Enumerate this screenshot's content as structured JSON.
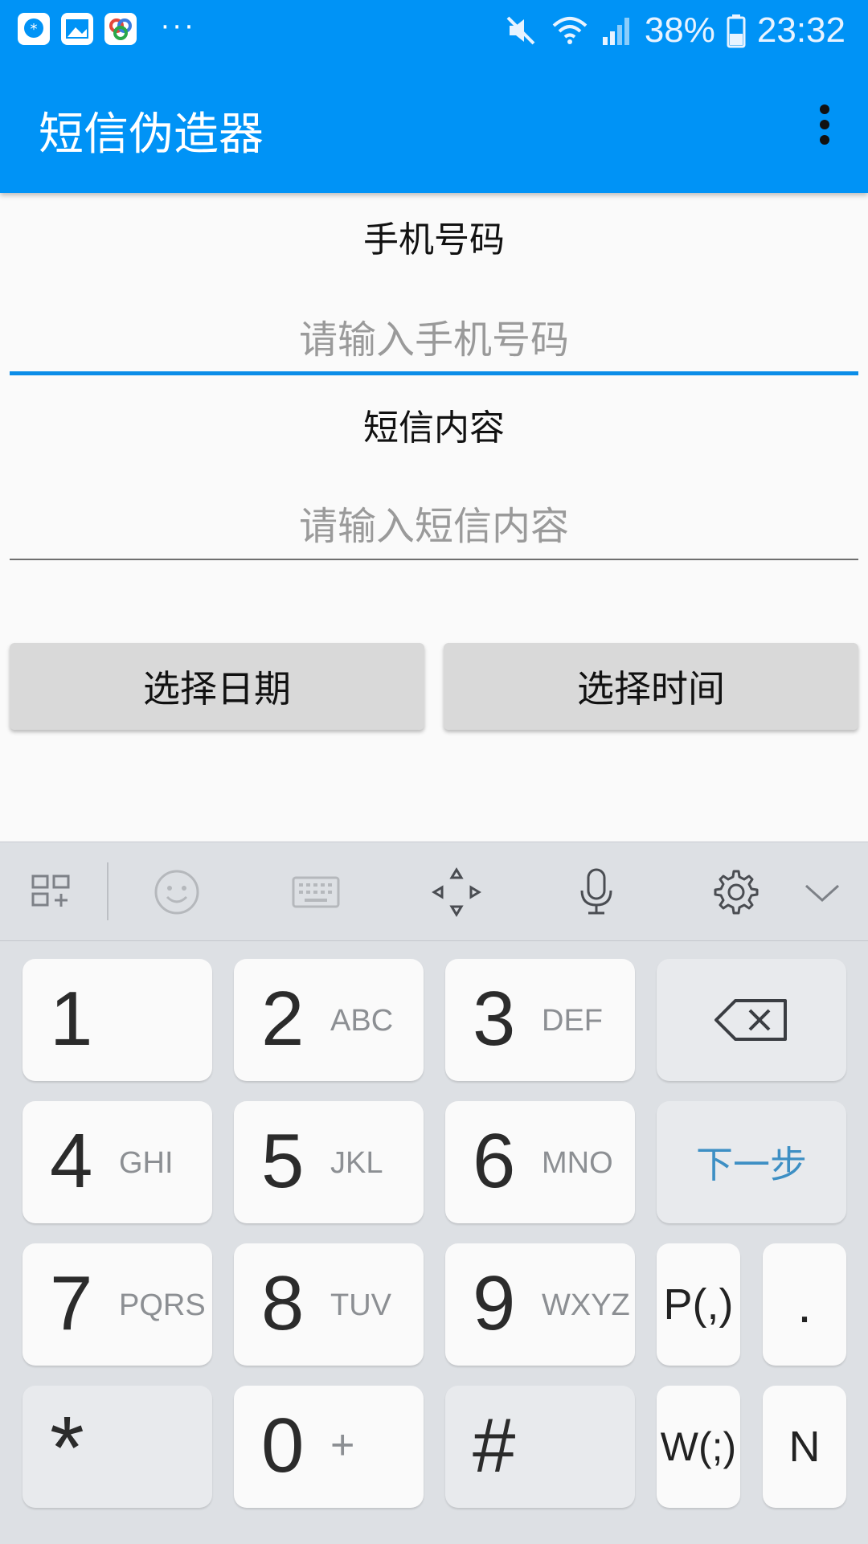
{
  "status_bar": {
    "battery": "38%",
    "time": "23:32",
    "notification_more": "···"
  },
  "app_bar": {
    "title": "短信伪造器"
  },
  "form": {
    "phone_label": "手机号码",
    "phone_placeholder": "请输入手机号码",
    "sms_label": "短信内容",
    "sms_placeholder": "请输入短信内容",
    "pick_date_label": "选择日期",
    "pick_time_label": "选择时间"
  },
  "colors": {
    "primary": "#0093f6",
    "focus_line": "#0b8de8",
    "next_text": "#3d8fc4"
  },
  "keyboard": {
    "toolbar_icons": [
      "grid-plus-icon",
      "emoji-icon",
      "keyboard-icon",
      "move-arrows-icon",
      "microphone-icon",
      "settings-icon",
      "collapse-chevron-icon"
    ],
    "keys": {
      "k1": {
        "num": "1",
        "sub": ""
      },
      "k2": {
        "num": "2",
        "sub": "ABC"
      },
      "k3": {
        "num": "3",
        "sub": "DEF"
      },
      "k4": {
        "num": "4",
        "sub": "GHI"
      },
      "k5": {
        "num": "5",
        "sub": "JKL"
      },
      "k6": {
        "num": "6",
        "sub": "MNO"
      },
      "k7": {
        "num": "7",
        "sub": "PQRS"
      },
      "k8": {
        "num": "8",
        "sub": "TUV"
      },
      "k9": {
        "num": "9",
        "sub": "WXYZ"
      },
      "k0": {
        "num": "0",
        "sub": "+"
      },
      "star": "*",
      "hash": "#",
      "next": "下一步",
      "pause": "P(,)",
      "dot": ".",
      "wait": "W(;)",
      "n": "N"
    }
  }
}
